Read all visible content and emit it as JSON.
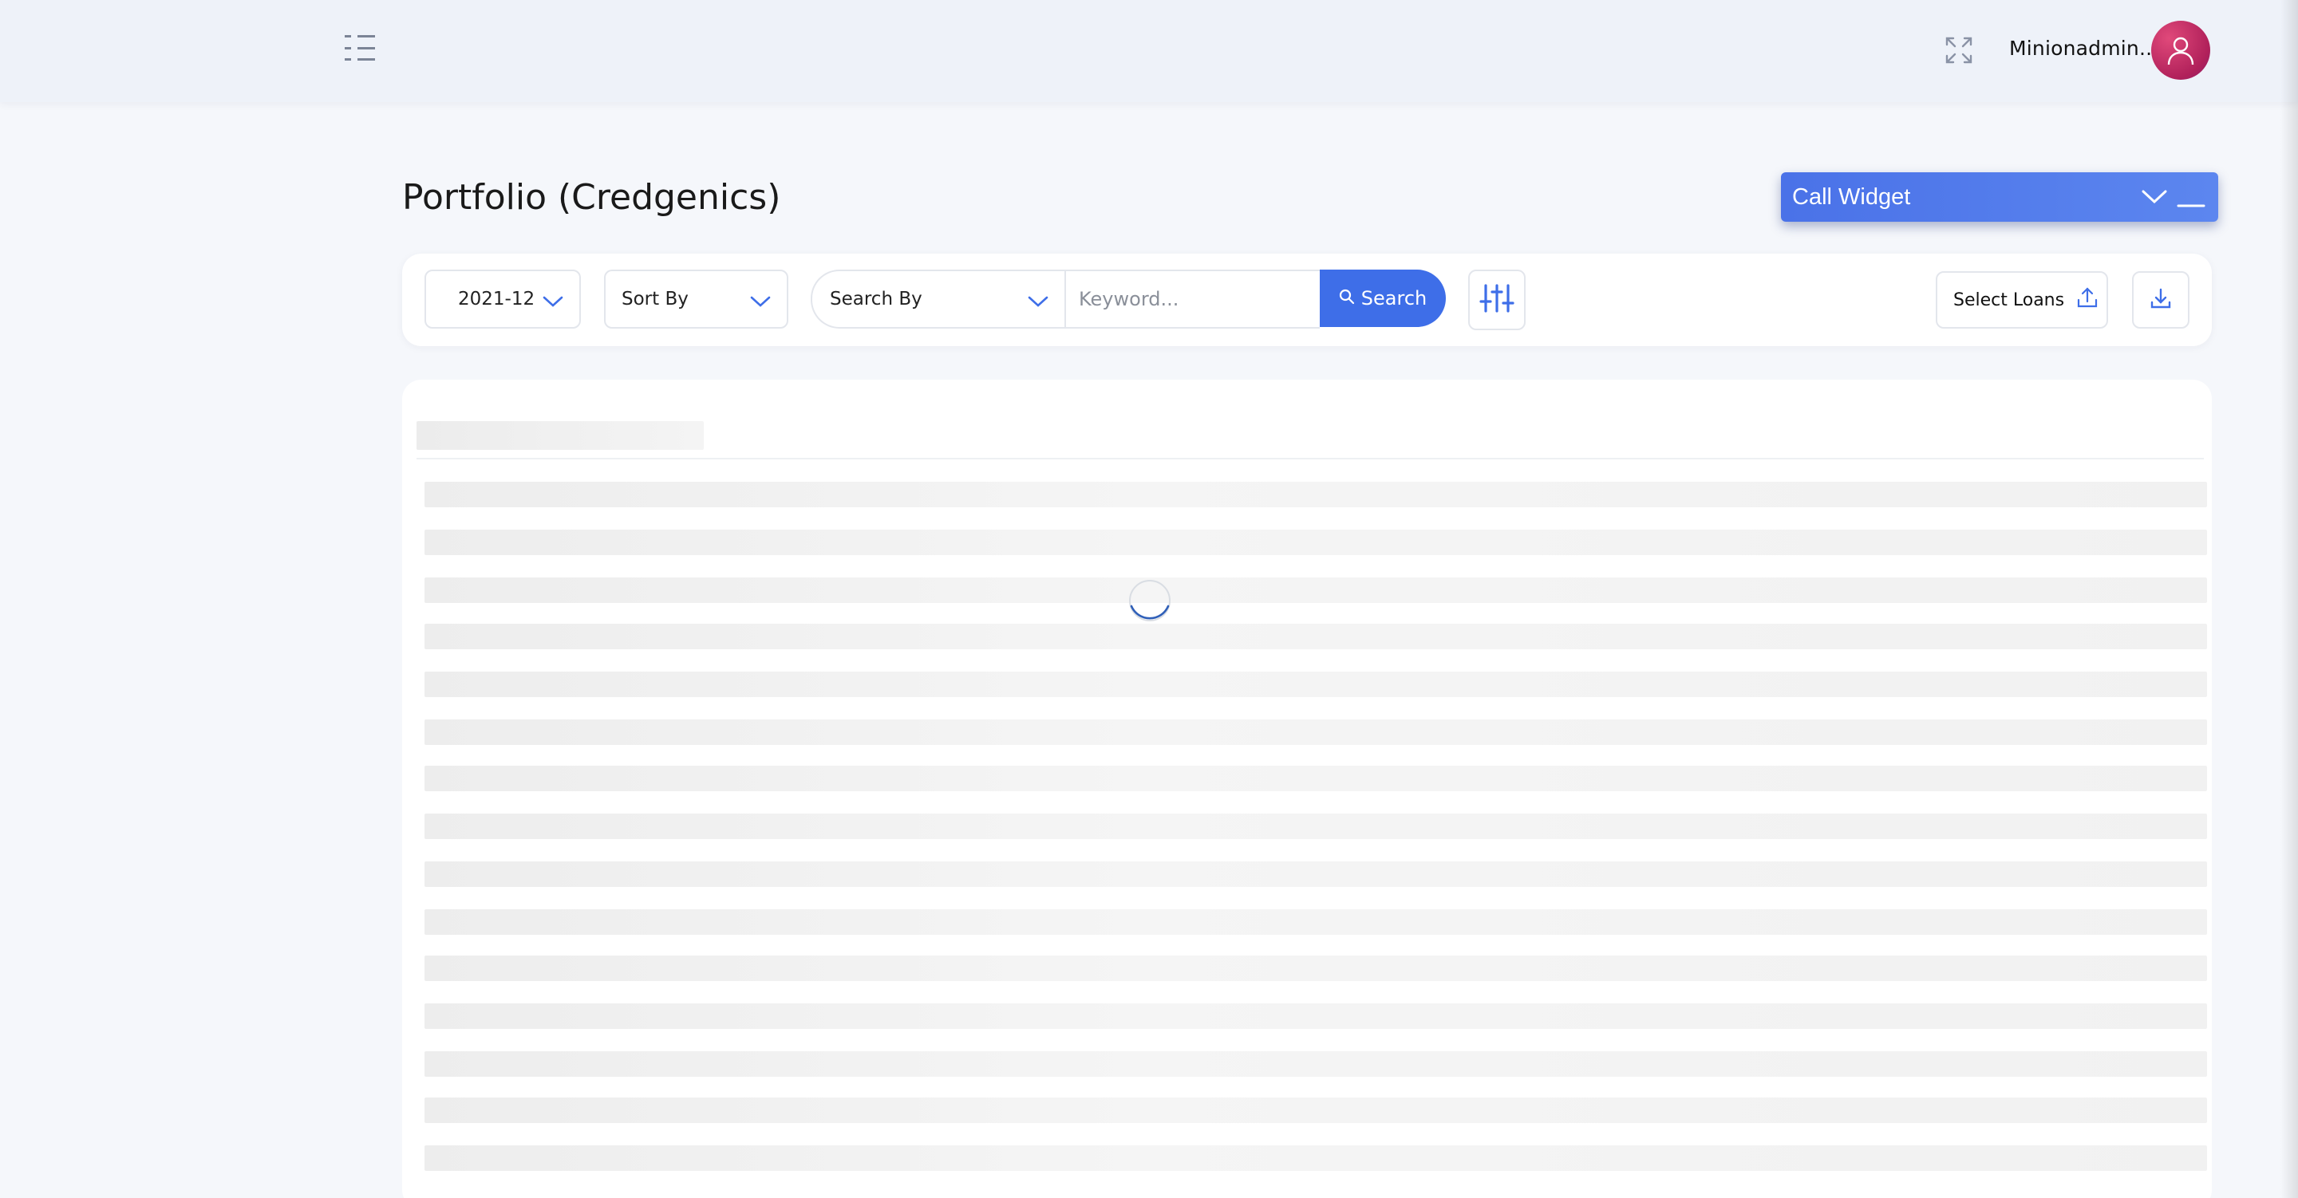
{
  "header": {
    "username": "Minionadmin..",
    "icons": {
      "menu": "menu-toggle-icon",
      "fullscreen": "fullscreen-icon",
      "avatar": "user-avatar-icon"
    }
  },
  "page": {
    "title": "Portfolio (Credgenics)"
  },
  "call_widget": {
    "title": "Call Widget"
  },
  "filters": {
    "month": "2021-12",
    "sort_by": "Sort By",
    "search_by": "Search By",
    "keyword_placeholder": "Keyword...",
    "search_label": "Search",
    "select_loans_label": "Select Loans"
  },
  "colors": {
    "accent": "#3e6ee8",
    "call_widget": "#4a72e8",
    "avatar": "#c02a64"
  },
  "loading": true
}
